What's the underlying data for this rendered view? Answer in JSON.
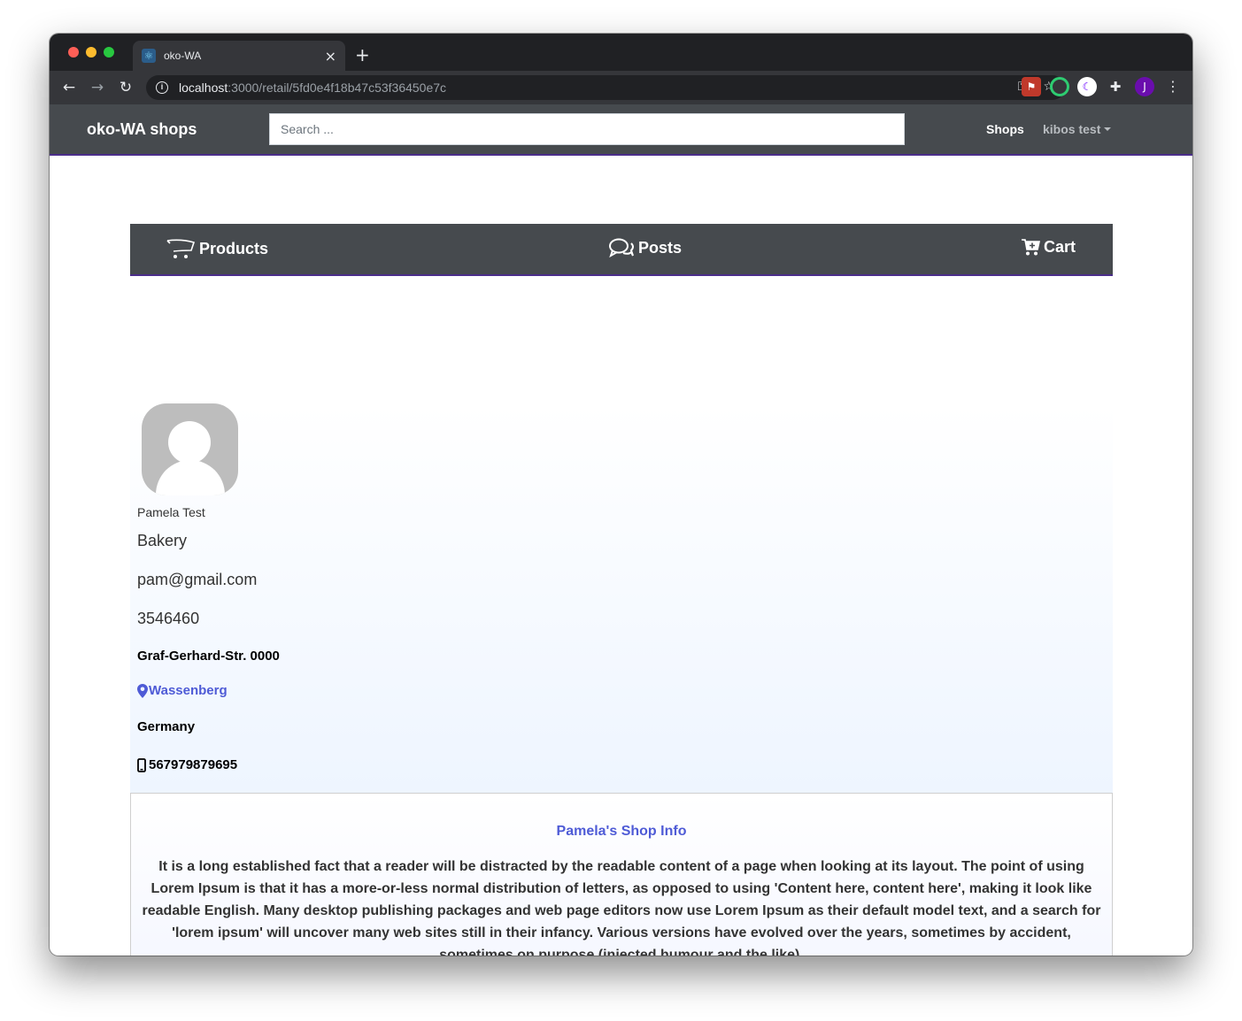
{
  "browser": {
    "tab_title": "oko-WA",
    "tab_close": "×",
    "new_tab": "+",
    "url_host": "localhost",
    "url_rest": ":3000/retail/5fd0e4f18b47c53f36450e7c",
    "profile_initial": "J"
  },
  "navbar": {
    "brand": "oko-WA shops",
    "search_placeholder": "Search ...",
    "shops_link": "Shops",
    "user_menu": "kibos test"
  },
  "shop_tabs": {
    "products": "Products",
    "posts": "Posts",
    "cart": "Cart"
  },
  "profile": {
    "owner": "Pamela Test",
    "category": "Bakery",
    "email": "pam@gmail.com",
    "phone": "3546460",
    "street": "Graf-Gerhard-Str. 0000",
    "city": "Wassenberg",
    "country": "Germany",
    "mobile": "567979879695"
  },
  "shop_info": {
    "title": "Pamela's Shop Info",
    "text": "It is a long established fact that a reader will be distracted by the readable content of a page when looking at its layout. The point of using Lorem Ipsum is that it has a more-or-less normal distribution of letters, as opposed to using 'Content here, content here', making it look like readable English. Many desktop publishing packages and web page editors now use Lorem Ipsum as their default model text, and a search for 'lorem ipsum' will uncover many web sites still in their infancy. Various versions have evolved over the years, sometimes by accident, sometimes on purpose (injected humour and the like)."
  },
  "colors": {
    "navbar_bg": "#464a4e",
    "accent_purple": "#4b2d8a",
    "link_blue": "#4e5bd6"
  }
}
